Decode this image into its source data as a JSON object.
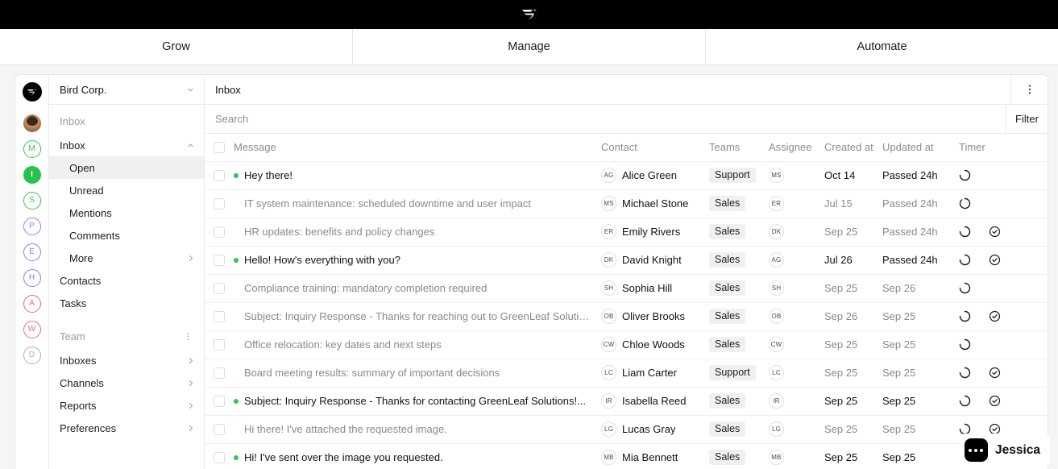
{
  "topbar": {
    "logo_icon": "bird-logo-icon"
  },
  "tabs": [
    {
      "label": "Grow",
      "active": false
    },
    {
      "label": "Manage",
      "active": true
    },
    {
      "label": "Automate",
      "active": false
    }
  ],
  "rail": {
    "logo_icon": "bird-logo-icon",
    "avatars": [
      {
        "initial": "M",
        "color": "#34c759",
        "filled": false
      },
      {
        "initial": "I",
        "color": "#27c24c",
        "filled": true
      },
      {
        "initial": "S",
        "color": "#34c759",
        "filled": false
      },
      {
        "initial": "P",
        "color": "#8a7ff0",
        "filled": false
      },
      {
        "initial": "E",
        "color": "#8a7ff0",
        "filled": false
      },
      {
        "initial": "H",
        "color": "#8a7ff0",
        "filled": false
      },
      {
        "initial": "A",
        "color": "#f06292",
        "filled": false
      },
      {
        "initial": "W",
        "color": "#f06292",
        "filled": false
      },
      {
        "initial": "D",
        "color": "#b0b0b0",
        "filled": false
      }
    ]
  },
  "sidebar": {
    "org_name": "Bird Corp.",
    "section_inbox_label": "Inbox",
    "items": [
      {
        "label": "Inbox",
        "type": "group",
        "expanded": true
      },
      {
        "label": "Open",
        "type": "sub",
        "active": true
      },
      {
        "label": "Unread",
        "type": "sub",
        "active": false
      },
      {
        "label": "Mentions",
        "type": "sub",
        "active": false
      },
      {
        "label": "Comments",
        "type": "sub",
        "active": false
      },
      {
        "label": "More",
        "type": "sub",
        "active": false,
        "chevron": "right"
      },
      {
        "label": "Contacts",
        "type": "item"
      },
      {
        "label": "Tasks",
        "type": "item"
      }
    ],
    "team_label": "Team",
    "team_items": [
      {
        "label": "Inboxes",
        "chevron": "right"
      },
      {
        "label": "Channels",
        "chevron": "right"
      },
      {
        "label": "Reports",
        "chevron": "right"
      },
      {
        "label": "Preferences",
        "chevron": "right"
      }
    ]
  },
  "main": {
    "title": "Inbox",
    "kebab_icon": "kebab-vertical-icon",
    "search_placeholder": "Search",
    "search_value": "",
    "filter_label": "Filter"
  },
  "table": {
    "columns": [
      "Message",
      "Contact",
      "Teams",
      "Assignee",
      "Created at",
      "Updated at",
      "Timer"
    ],
    "rows": [
      {
        "unread": true,
        "message": "Hey there!",
        "contact": "Alice Green",
        "contact_initials": "AG",
        "team": "Support",
        "assignee": "MS",
        "created": "Oct 14",
        "updated": "Passed 24h",
        "timer": "partial",
        "check": false
      },
      {
        "unread": false,
        "message": "IT system maintenance: scheduled downtime and user impact",
        "contact": "Michael Stone",
        "contact_initials": "MS",
        "team": "Sales",
        "assignee": "ER",
        "created": "Jul 15",
        "updated": "Passed 24h",
        "timer": "almost-full",
        "check": false
      },
      {
        "unread": false,
        "message": "HR updates: benefits and policy changes",
        "contact": "Emily Rivers",
        "contact_initials": "ER",
        "team": "Sales",
        "assignee": "DK",
        "created": "Sep 25",
        "updated": "Passed 24h",
        "timer": "partial",
        "check": true
      },
      {
        "unread": true,
        "message": "Hello! How's everything with you?",
        "contact": "David Knight",
        "contact_initials": "DK",
        "team": "Sales",
        "assignee": "AG",
        "created": "Jul 26",
        "updated": "Passed 24h",
        "timer": "partial",
        "check": true
      },
      {
        "unread": false,
        "message": "Compliance training: mandatory completion required",
        "contact": "Sophia Hill",
        "contact_initials": "SH",
        "team": "Sales",
        "assignee": "SH",
        "created": "Sep 25",
        "updated": "Sep 26",
        "timer": "partial",
        "check": false
      },
      {
        "unread": false,
        "message": "Subject: Inquiry Response - Thanks for reaching out to GreenLeaf Solutions...",
        "contact": "Oliver Brooks",
        "contact_initials": "OB",
        "team": "Sales",
        "assignee": "OB",
        "created": "Sep 26",
        "updated": "Sep 25",
        "timer": "partial",
        "check": true
      },
      {
        "unread": false,
        "message": "Office relocation: key dates and next steps",
        "contact": "Chloe Woods",
        "contact_initials": "CW",
        "team": "Sales",
        "assignee": "CW",
        "created": "Sep 25",
        "updated": "Sep 25",
        "timer": "partial",
        "check": false
      },
      {
        "unread": false,
        "message": "Board meeting results: summary of important decisions",
        "contact": "Liam Carter",
        "contact_initials": "LC",
        "team": "Support",
        "assignee": "LC",
        "created": "Sep 25",
        "updated": "Sep 25",
        "timer": "partial",
        "check": true
      },
      {
        "unread": true,
        "message": "Subject: Inquiry Response - Thanks for contacting GreenLeaf Solutions!...",
        "contact": "Isabella Reed",
        "contact_initials": "IR",
        "team": "Sales",
        "assignee": "IR",
        "created": "Sep 25",
        "updated": "Sep 25",
        "timer": "partial",
        "check": true
      },
      {
        "unread": false,
        "message": "Hi there! I've attached the requested image.",
        "contact": "Lucas Gray",
        "contact_initials": "LG",
        "team": "Sales",
        "assignee": "LG",
        "created": "Sep 25",
        "updated": "Sep 25",
        "timer": "partial",
        "check": true
      },
      {
        "unread": true,
        "message": "Hi! I've sent over the image you requested.",
        "contact": "Mia Bennett",
        "contact_initials": "MB",
        "team": "Sales",
        "assignee": "MB",
        "created": "Sep 25",
        "updated": "Sep 25",
        "timer": "none",
        "check": false
      }
    ]
  },
  "chat_widget": {
    "name": "Jessica",
    "icon": "chat-dots-icon"
  },
  "colors": {
    "accent_green": "#2fc55a",
    "topbar_bg": "#000000",
    "border": "#eaeaea",
    "muted_text": "#8a8a8a",
    "badge_bg": "#f0f0f0"
  }
}
